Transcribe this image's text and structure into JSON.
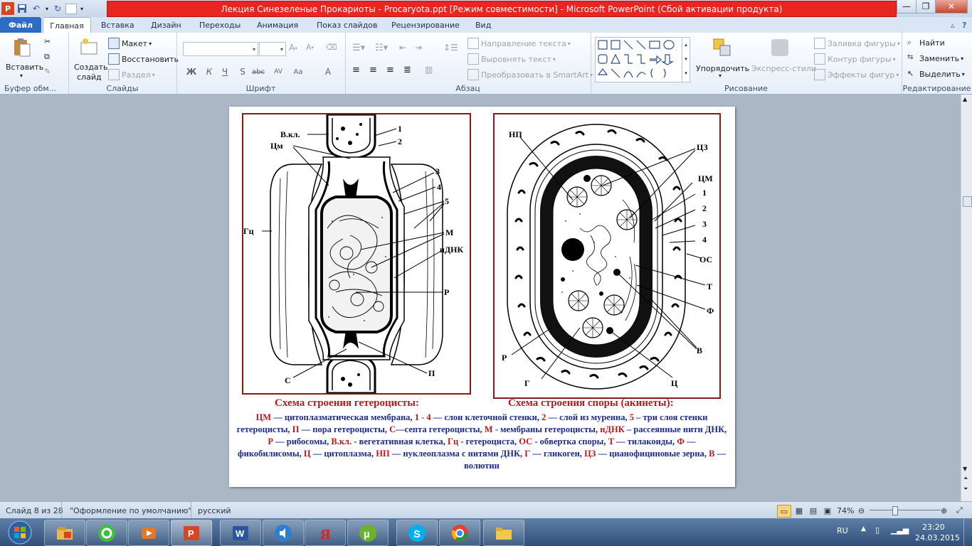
{
  "window": {
    "title": "Лекция Синезеленые Прокариоты - Procaryota.ppt [Режим совместимости] -  Microsoft PowerPoint (Сбой активации продукта)"
  },
  "tabs": [
    "Файл",
    "Главная",
    "Вставка",
    "Дизайн",
    "Переходы",
    "Анимация",
    "Показ слайдов",
    "Рецензирование",
    "Вид"
  ],
  "ribbon": {
    "clipboard": {
      "label": "Буфер обм...",
      "paste": "Вставить"
    },
    "slides": {
      "label": "Слайды",
      "new_slide_1": "Создать",
      "new_slide_2": "слайд",
      "layout": "Макет",
      "reset": "Восстановить",
      "section": "Раздел"
    },
    "font": {
      "label": "Шрифт",
      "bold": "Ж",
      "italic": "К",
      "underline": "Ч",
      "shadow": "S",
      "strike": "abc",
      "spacing": "AV",
      "case": "Aa",
      "color": "A"
    },
    "paragraph": {
      "label": "Абзац",
      "text_direction": "Направление текста",
      "align_text": "Выровнять текст",
      "smartart": "Преобразовать в SmartArt"
    },
    "drawing": {
      "label": "Рисование",
      "arrange": "Упорядочить",
      "quick_styles": "Экспресс-стили",
      "fill": "Заливка фигуры",
      "outline": "Контур фигуры",
      "effects": "Эффекты фигур"
    },
    "editing": {
      "label": "Редактирование",
      "find": "Найти",
      "replace": "Заменить",
      "select": "Выделить"
    }
  },
  "slide": {
    "caption_left": "Схема строения  гетероцисты:",
    "caption_right": "Схема строения споры (акинеты):",
    "left_labels": {
      "vkl": "В.кл.",
      "cm": "Цм",
      "gc": "Гц",
      "n1": "1",
      "n2": "2",
      "n3": "3",
      "n4": "4",
      "n5": "5",
      "m": "М",
      "idnk": "иДНК",
      "r": "Р",
      "s": "С",
      "p": "П"
    },
    "right_labels": {
      "np": "НП",
      "cz": "ЦЗ",
      "cm": "ЦМ",
      "n1": "1",
      "n2": "2",
      "n3": "3",
      "n4": "4",
      "os": "ОС",
      "t": "Т",
      "f": "Ф",
      "v": "В",
      "c": "Ц",
      "g": "Г",
      "r": "Р"
    },
    "legend": [
      {
        "k": "ЦМ",
        "t": " — цитоплазматическая мембрана, "
      },
      {
        "k": "1 - 4",
        "t": " — слои клеточной стенки, "
      },
      {
        "k": "2",
        "t": " — слой из муреина, "
      },
      {
        "k": "5",
        "t": " – три слоя стенки гетероцисты, "
      },
      {
        "k": "П",
        "t": " — пора гетероцисты, "
      },
      {
        "k": "С",
        "t": "—септа гетероцисты, "
      },
      {
        "k": "М",
        "t": " -  мембраны гетероцисты, "
      },
      {
        "k": "нДНК",
        "t": " – рассеянные нити ДНК, "
      },
      {
        "k": "Р",
        "t": " — рибосомы, "
      },
      {
        "k": "В.кл.",
        "t": " - вегетативная клетка, "
      },
      {
        "k": "Гц",
        "t": " -  гетероциста, "
      },
      {
        "k": "ОС",
        "t": " - обвертка споры, "
      },
      {
        "k": "Т",
        "t": " — тилакоиды, "
      },
      {
        "k": "Ф",
        "t": " — фикобилисомы, "
      },
      {
        "k": "Ц",
        "t": " — цитоплазма, "
      },
      {
        "k": "НП",
        "t": " — нуклеоплазма с нитями ДНК, "
      },
      {
        "k": "Г",
        "t": " — гликоген, "
      },
      {
        "k": "ЦЗ",
        "t": " — цианофициновые зерна, "
      },
      {
        "k": "В",
        "t": " — волютин"
      }
    ]
  },
  "status": {
    "slide": "Слайд 8 из 28",
    "theme": "\"Оформление по умолчанию\"",
    "lang": "русский",
    "zoom": "74%"
  },
  "tray": {
    "lang": "RU",
    "time": "23:20",
    "date": "24.03.2015"
  },
  "taskbar_apps": [
    "file-explorer",
    "icq",
    "media-player",
    "powerpoint",
    "word",
    "audio",
    "yandex",
    "utorrent",
    "skype",
    "chrome",
    "folder"
  ]
}
